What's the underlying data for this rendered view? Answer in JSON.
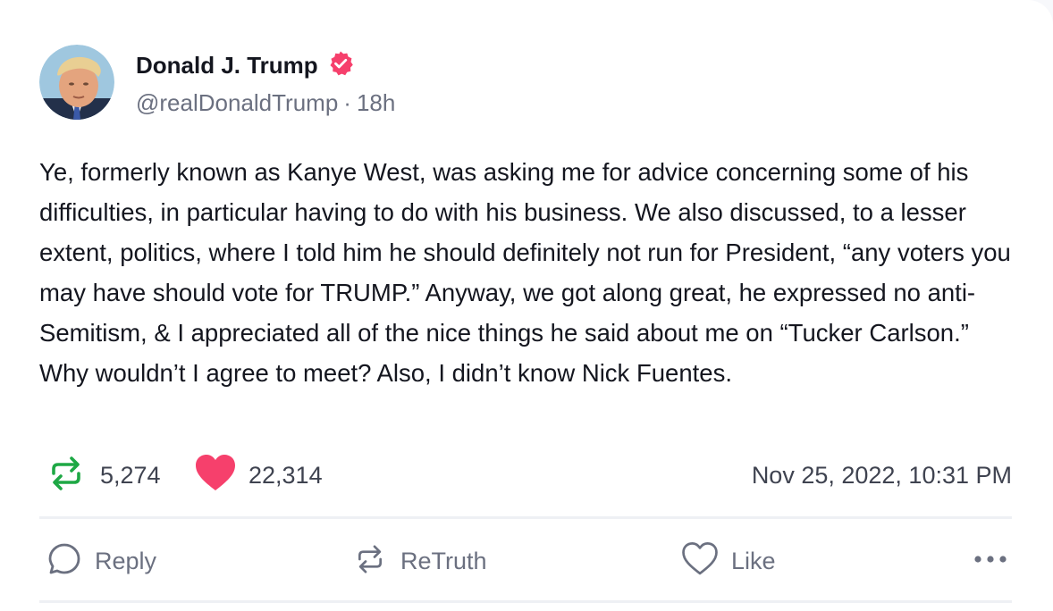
{
  "post": {
    "display_name": "Donald J. Trump",
    "handle": "@realDonaldTrump",
    "separator": "·",
    "relative_time": "18h",
    "text": "Ye, formerly known as Kanye West, was asking me for advice concerning some of his difficulties, in particular having to do with his business. We also discussed, to a lesser extent, politics, where I told him he should definitely not run for President, “any voters you may have should vote for TRUMP.” Anyway, we got along great, he expressed no anti-Semitism, & I appreciated all of the nice things he said about me on “Tucker Carlson.” Why wouldn’t I agree to meet? Also, I didn’t know Nick Fuentes.",
    "retruth_count": "5,274",
    "like_count": "22,314",
    "timestamp": "Nov 25, 2022, 10:31 PM"
  },
  "actions": {
    "reply_label": "Reply",
    "retruth_label": "ReTruth",
    "like_label": "Like"
  },
  "icons": {
    "verified": "verified-badge-icon",
    "retruth_stat": "retruth-icon",
    "like_stat": "heart-filled-icon",
    "reply": "speech-bubble-icon",
    "retruth": "retruth-icon",
    "like": "heart-outline-icon",
    "more": "more-dots-icon"
  },
  "colors": {
    "verified": "#f6406c",
    "retruth_green": "#1ea845",
    "like_pink": "#f6406c",
    "text": "#14161f",
    "muted": "#6b7080"
  }
}
